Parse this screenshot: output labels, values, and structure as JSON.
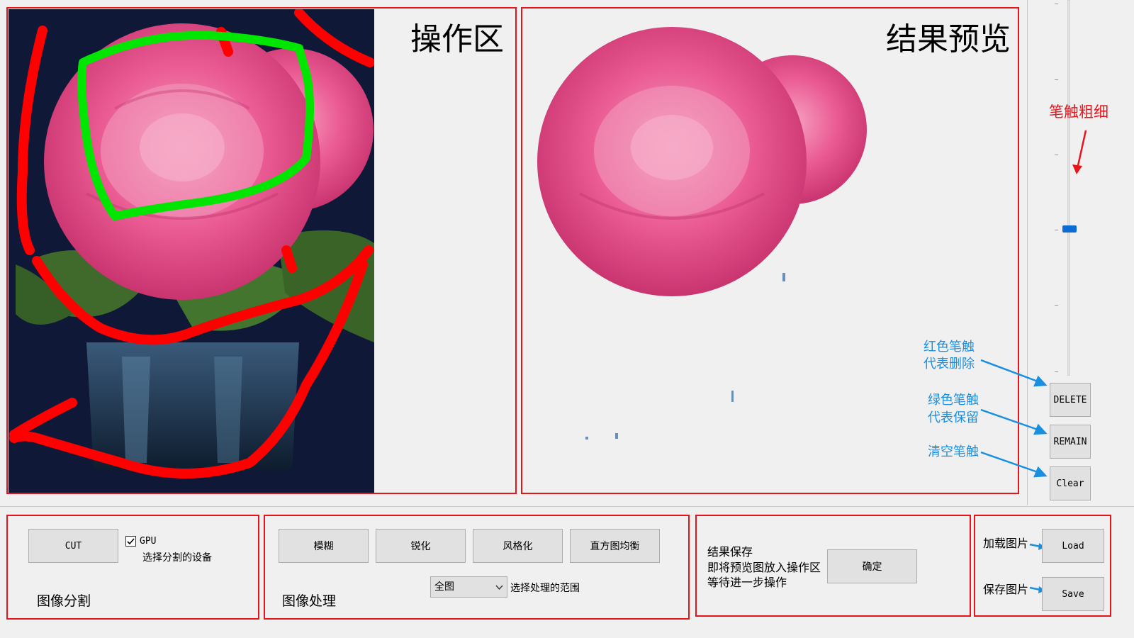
{
  "work_area": {
    "title": "操作区"
  },
  "preview_area": {
    "title": "结果预览"
  },
  "side_panel": {
    "brush_size_label": "笔触粗细",
    "brush_size_level": 0.38,
    "buttons": {
      "delete": "DELETE",
      "remain": "REMAIN",
      "clear": "Clear"
    },
    "annotations": {
      "delete_line1": "红色笔触",
      "delete_line2": "代表删除",
      "remain_line1": "绿色笔触",
      "remain_line2": "代表保留",
      "clear": "清空笔触"
    }
  },
  "segmentation": {
    "cut_label": "CUT",
    "gpu_label": "GPU",
    "gpu_checked": true,
    "device_hint": "选择分割的设备",
    "group_title": "图像分割"
  },
  "processing": {
    "buttons": [
      "模糊",
      "锐化",
      "风格化",
      "直方图均衡"
    ],
    "range_value": "全图",
    "range_hint": "选择处理的范围",
    "group_title": "图像处理"
  },
  "save_result": {
    "line1": "结果保存",
    "line2": "即将预览图放入操作区",
    "line3": "等待进一步操作",
    "confirm_label": "确定"
  },
  "file_ops": {
    "load_caption": "加载图片",
    "load_label": "Load",
    "save_caption": "保存图片",
    "save_label": "Save"
  },
  "colors": {
    "frame_red": "#e8141c",
    "annotation_blue": "#1a8fe0",
    "stroke_red": "#ff0000",
    "stroke_green": "#00e600",
    "flower_pink": "#e8508c"
  }
}
